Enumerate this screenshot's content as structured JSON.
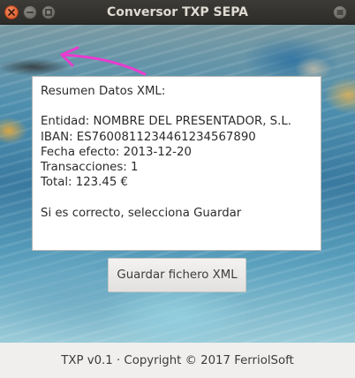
{
  "window": {
    "title": "Conversor TXP SEPA"
  },
  "summary": {
    "lines": [
      "Resumen Datos XML:",
      "",
      "Entidad: NOMBRE DEL PRESENTADOR, S.L.",
      "IBAN: ES7600811234461234567890",
      "Fecha efecto: 2013-12-20",
      "Transacciones: 1",
      "Total: 123.45 €",
      "",
      "Si es correcto, selecciona Guardar"
    ]
  },
  "actions": {
    "save_label": "Guardar fichero XML"
  },
  "footer": {
    "text": "TXP v0.1 · Copyright © 2017 FerriolSoft"
  },
  "colors": {
    "titlebar": "#3c3b37",
    "close_button": "#e5642a",
    "arrow": "#e83ccf"
  }
}
